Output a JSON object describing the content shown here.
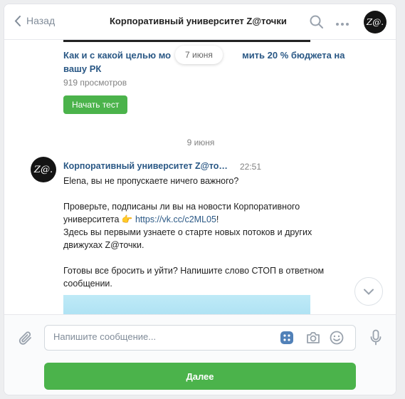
{
  "header": {
    "back_label": "Назад",
    "title": "Корпоративный университет Z@точки",
    "avatar_text": "Z@."
  },
  "feed": {
    "link_title": "Как и с какой целью мо",
    "link_title_tail": "мить 20 % бюджета на вашу РК",
    "floating_date": "7 июня",
    "views": "919 просмотров",
    "start_test_label": "Начать тест",
    "date_separator": "9 июня",
    "message": {
      "avatar_text": "Z@.",
      "author": "Корпоративный университет Z@то…",
      "time": "22:51",
      "lines": {
        "l1": "Elena, вы не пропускаете ничего важного?",
        "l2": "Проверьте, подписаны ли вы на новости Корпоративного",
        "l3_prefix": "университета",
        "l3_emoji": "👉",
        "l3_link": "https://vk.cc/c2ML05",
        "l3_suffix": "!",
        "l4": "Здесь вы первыми узнаете о старте новых потоков и других",
        "l5": "движухах Z@точки.",
        "l6": "Готовы все бросить и уйти? Напишите слово СТОП в ответном",
        "l7": "сообщении."
      }
    }
  },
  "composer": {
    "placeholder": "Напишите сообщение...",
    "next_label": "Далее"
  },
  "colors": {
    "accent_green": "#4bb34b",
    "link_blue": "#2a5885",
    "icon_gray": "#99a2ad"
  }
}
